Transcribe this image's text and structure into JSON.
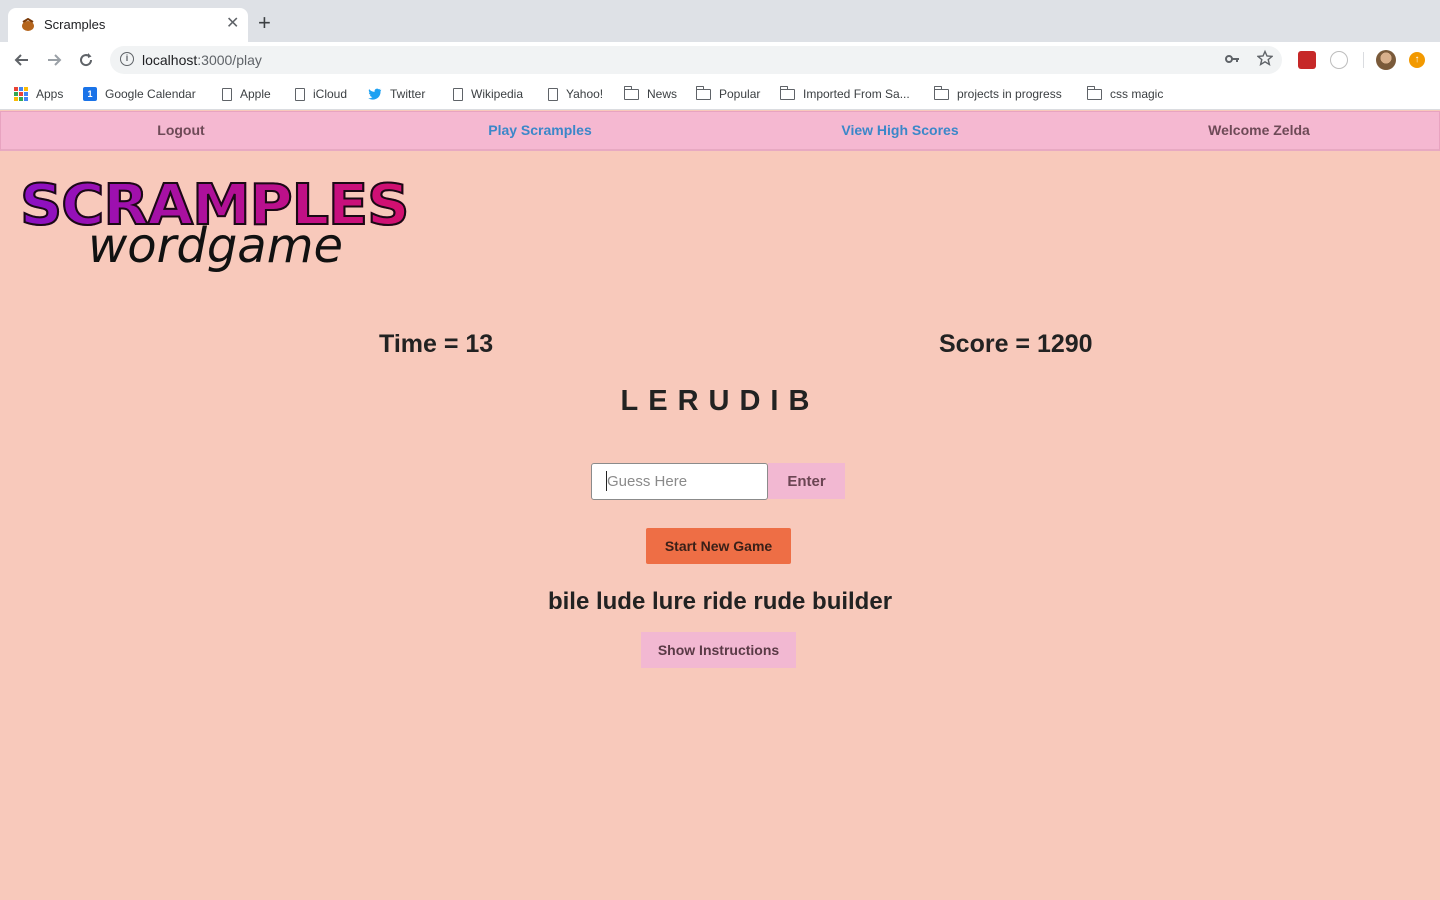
{
  "browser": {
    "tab": {
      "title": "Scramples",
      "close_glyph": "✕"
    },
    "new_tab_glyph": "+",
    "url": {
      "host": "localhost",
      "path": ":3000/play"
    },
    "bookmarks": [
      {
        "label": "Apps",
        "icon": "apps-grid-icon"
      },
      {
        "label": "Google Calendar",
        "icon": "calendar-icon"
      },
      {
        "label": "Apple",
        "icon": "page-icon"
      },
      {
        "label": "iCloud",
        "icon": "page-icon"
      },
      {
        "label": "Twitter",
        "icon": "twitter-icon"
      },
      {
        "label": "Wikipedia",
        "icon": "page-icon"
      },
      {
        "label": "Yahoo!",
        "icon": "page-icon"
      },
      {
        "label": "News",
        "icon": "folder-icon"
      },
      {
        "label": "Popular",
        "icon": "folder-icon"
      },
      {
        "label": "Imported From Sa...",
        "icon": "folder-icon"
      },
      {
        "label": "projects in progress",
        "icon": "folder-icon"
      },
      {
        "label": "css magic",
        "icon": "folder-icon"
      }
    ]
  },
  "nav": {
    "logout": "Logout",
    "play": "Play Scramples",
    "high_scores": "View High Scores",
    "welcome": "Welcome Zelda"
  },
  "logo": {
    "title": "SCRAMPLES",
    "subtitle": "wordgame"
  },
  "game": {
    "time": "Time = 13",
    "score": "Score = 1290",
    "scrambled_letters": "LERUDIB",
    "guess_placeholder": "Guess Here",
    "guess_value": "",
    "enter_label": "Enter",
    "start_label": "Start New Game",
    "found_words": "bile lude lure ride rude builder",
    "instructions_label": "Show Instructions"
  },
  "colors": {
    "page_bg": "#f8c9bb",
    "nav_bg": "#f5b8d1",
    "link": "#3b87c9",
    "start_button": "#ee6e45",
    "secondary_button": "#f2b8d2"
  }
}
